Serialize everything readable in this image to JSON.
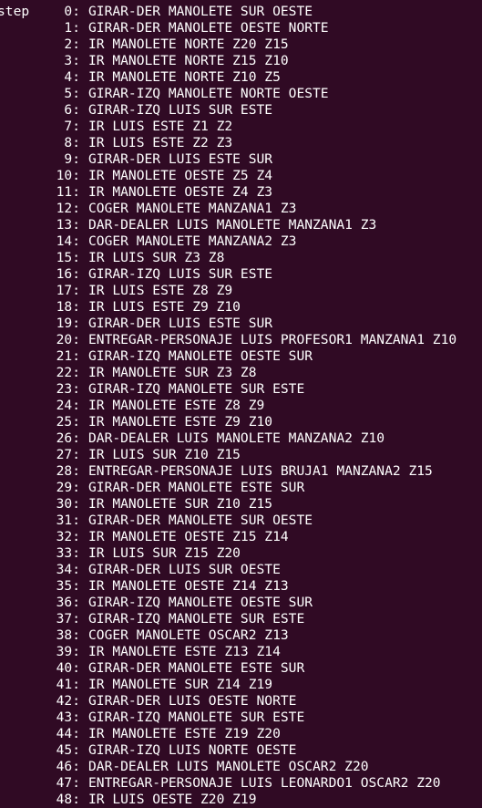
{
  "terminal": {
    "label": "step",
    "steps": [
      {
        "n": "0:",
        "cmd": "GIRAR-DER MANOLETE SUR OESTE"
      },
      {
        "n": "1:",
        "cmd": "GIRAR-DER MANOLETE OESTE NORTE"
      },
      {
        "n": "2:",
        "cmd": "IR MANOLETE NORTE Z20 Z15"
      },
      {
        "n": "3:",
        "cmd": "IR MANOLETE NORTE Z15 Z10"
      },
      {
        "n": "4:",
        "cmd": "IR MANOLETE NORTE Z10 Z5"
      },
      {
        "n": "5:",
        "cmd": "GIRAR-IZQ MANOLETE NORTE OESTE"
      },
      {
        "n": "6:",
        "cmd": "GIRAR-IZQ LUIS SUR ESTE"
      },
      {
        "n": "7:",
        "cmd": "IR LUIS ESTE Z1 Z2"
      },
      {
        "n": "8:",
        "cmd": "IR LUIS ESTE Z2 Z3"
      },
      {
        "n": "9:",
        "cmd": "GIRAR-DER LUIS ESTE SUR"
      },
      {
        "n": "10:",
        "cmd": "IR MANOLETE OESTE Z5 Z4"
      },
      {
        "n": "11:",
        "cmd": "IR MANOLETE OESTE Z4 Z3"
      },
      {
        "n": "12:",
        "cmd": "COGER MANOLETE MANZANA1 Z3"
      },
      {
        "n": "13:",
        "cmd": "DAR-DEALER LUIS MANOLETE MANZANA1 Z3"
      },
      {
        "n": "14:",
        "cmd": "COGER MANOLETE MANZANA2 Z3"
      },
      {
        "n": "15:",
        "cmd": "IR LUIS SUR Z3 Z8"
      },
      {
        "n": "16:",
        "cmd": "GIRAR-IZQ LUIS SUR ESTE"
      },
      {
        "n": "17:",
        "cmd": "IR LUIS ESTE Z8 Z9"
      },
      {
        "n": "18:",
        "cmd": "IR LUIS ESTE Z9 Z10"
      },
      {
        "n": "19:",
        "cmd": "GIRAR-DER LUIS ESTE SUR"
      },
      {
        "n": "20:",
        "cmd": "ENTREGAR-PERSONAJE LUIS PROFESOR1 MANZANA1 Z10"
      },
      {
        "n": "21:",
        "cmd": "GIRAR-IZQ MANOLETE OESTE SUR"
      },
      {
        "n": "22:",
        "cmd": "IR MANOLETE SUR Z3 Z8"
      },
      {
        "n": "23:",
        "cmd": "GIRAR-IZQ MANOLETE SUR ESTE"
      },
      {
        "n": "24:",
        "cmd": "IR MANOLETE ESTE Z8 Z9"
      },
      {
        "n": "25:",
        "cmd": "IR MANOLETE ESTE Z9 Z10"
      },
      {
        "n": "26:",
        "cmd": "DAR-DEALER LUIS MANOLETE MANZANA2 Z10"
      },
      {
        "n": "27:",
        "cmd": "IR LUIS SUR Z10 Z15"
      },
      {
        "n": "28:",
        "cmd": "ENTREGAR-PERSONAJE LUIS BRUJA1 MANZANA2 Z15"
      },
      {
        "n": "29:",
        "cmd": "GIRAR-DER MANOLETE ESTE SUR"
      },
      {
        "n": "30:",
        "cmd": "IR MANOLETE SUR Z10 Z15"
      },
      {
        "n": "31:",
        "cmd": "GIRAR-DER MANOLETE SUR OESTE"
      },
      {
        "n": "32:",
        "cmd": "IR MANOLETE OESTE Z15 Z14"
      },
      {
        "n": "33:",
        "cmd": "IR LUIS SUR Z15 Z20"
      },
      {
        "n": "34:",
        "cmd": "GIRAR-DER LUIS SUR OESTE"
      },
      {
        "n": "35:",
        "cmd": "IR MANOLETE OESTE Z14 Z13"
      },
      {
        "n": "36:",
        "cmd": "GIRAR-IZQ MANOLETE OESTE SUR"
      },
      {
        "n": "37:",
        "cmd": "GIRAR-IZQ MANOLETE SUR ESTE"
      },
      {
        "n": "38:",
        "cmd": "COGER MANOLETE OSCAR2 Z13"
      },
      {
        "n": "39:",
        "cmd": "IR MANOLETE ESTE Z13 Z14"
      },
      {
        "n": "40:",
        "cmd": "GIRAR-DER MANOLETE ESTE SUR"
      },
      {
        "n": "41:",
        "cmd": "IR MANOLETE SUR Z14 Z19"
      },
      {
        "n": "42:",
        "cmd": "GIRAR-DER LUIS OESTE NORTE"
      },
      {
        "n": "43:",
        "cmd": "GIRAR-IZQ MANOLETE SUR ESTE"
      },
      {
        "n": "44:",
        "cmd": "IR MANOLETE ESTE Z19 Z20"
      },
      {
        "n": "45:",
        "cmd": "GIRAR-IZQ LUIS NORTE OESTE"
      },
      {
        "n": "46:",
        "cmd": "DAR-DEALER LUIS MANOLETE OSCAR2 Z20"
      },
      {
        "n": "47:",
        "cmd": "ENTREGAR-PERSONAJE LUIS LEONARDO1 OSCAR2 Z20"
      },
      {
        "n": "48:",
        "cmd": "IR LUIS OESTE Z20 Z19"
      }
    ]
  },
  "colors": {
    "background": "#300a24",
    "text": "#ffffff"
  }
}
